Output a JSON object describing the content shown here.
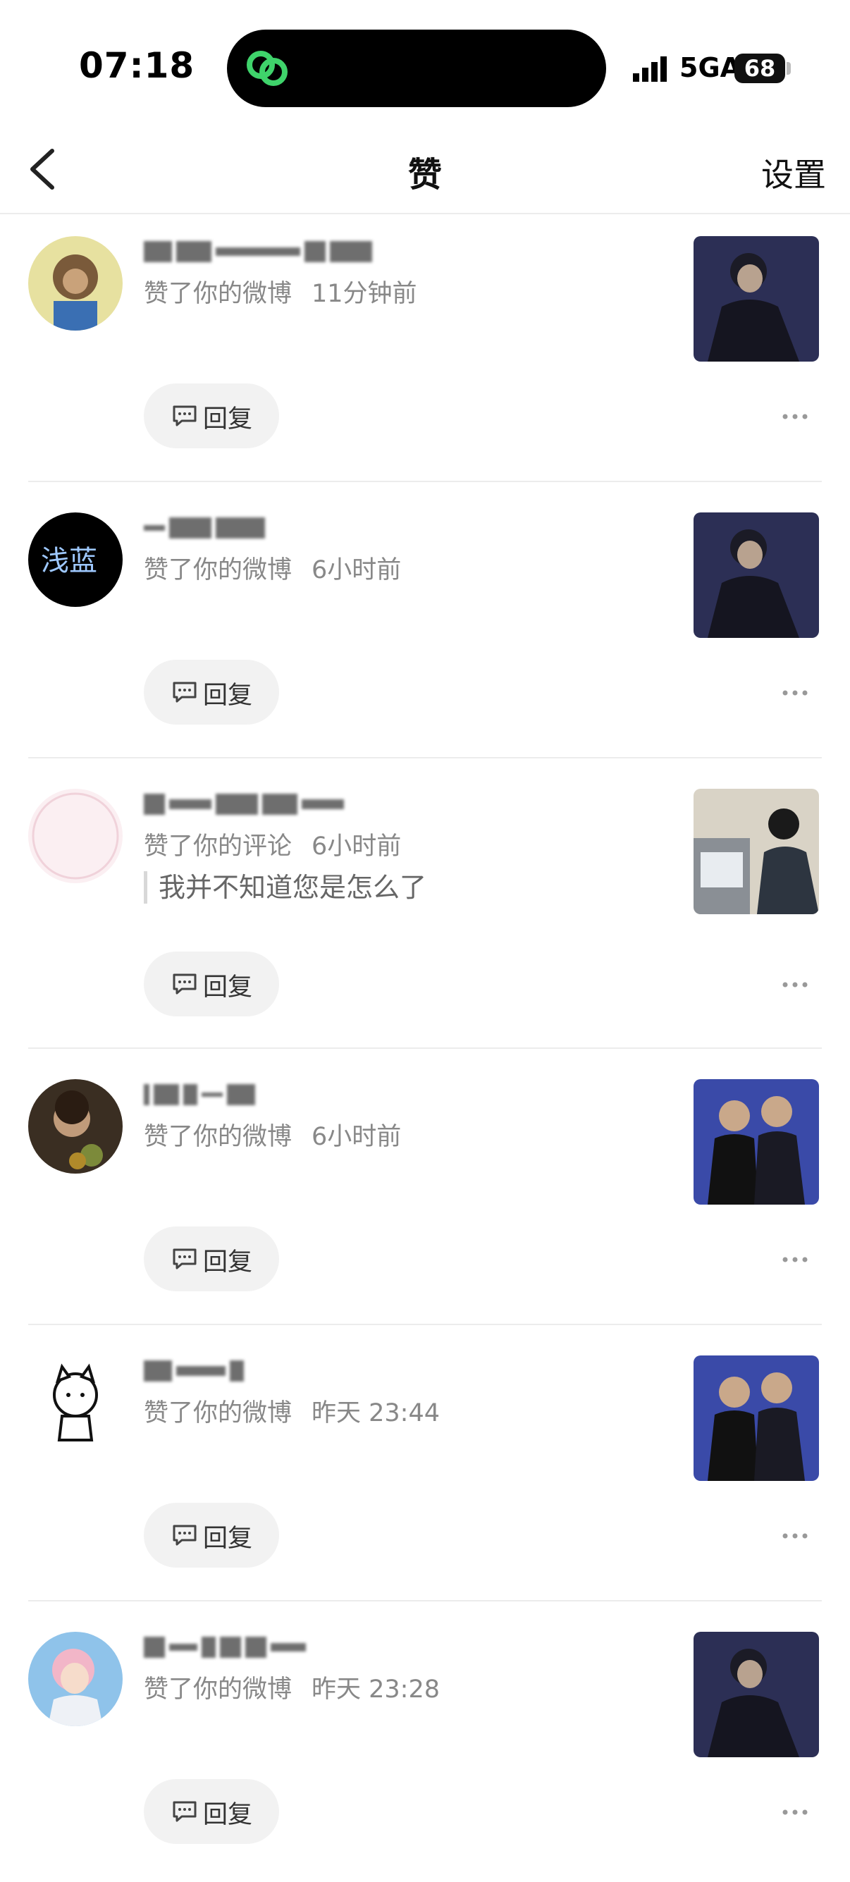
{
  "status_bar": {
    "time": "07:18",
    "network": "5GA",
    "battery": "68",
    "island_icon": "link-icon"
  },
  "nav": {
    "back_icon": "chevron-left-icon",
    "title": "赞",
    "settings_label": "设置"
  },
  "items": [
    {
      "action": "赞了你的微博",
      "time": "11分钟前",
      "quote": "",
      "reply_label": "回复",
      "thumb": "photo-man-dark"
    },
    {
      "action": "赞了你的微博",
      "time": "6小时前",
      "quote": "",
      "reply_label": "回复",
      "thumb": "photo-man-dark"
    },
    {
      "action": "赞了你的评论",
      "time": "6小时前",
      "quote": "我并不知道您是怎么了",
      "reply_label": "回复",
      "thumb": "photo-office"
    },
    {
      "action": "赞了你的微博",
      "time": "6小时前",
      "quote": "",
      "reply_label": "回复",
      "thumb": "photo-two-men"
    },
    {
      "action": "赞了你的微博",
      "time": "昨天 23:44",
      "quote": "",
      "reply_label": "回复",
      "thumb": "photo-two-men"
    },
    {
      "action": "赞了你的微博",
      "time": "昨天 23:28",
      "quote": "",
      "reply_label": "回复",
      "thumb": "photo-man-dark"
    }
  ],
  "colors": {
    "secondary_text": "#888888",
    "reply_bg": "#f2f2f2",
    "divider": "#ececec",
    "island_icon": "#3fd36b"
  }
}
